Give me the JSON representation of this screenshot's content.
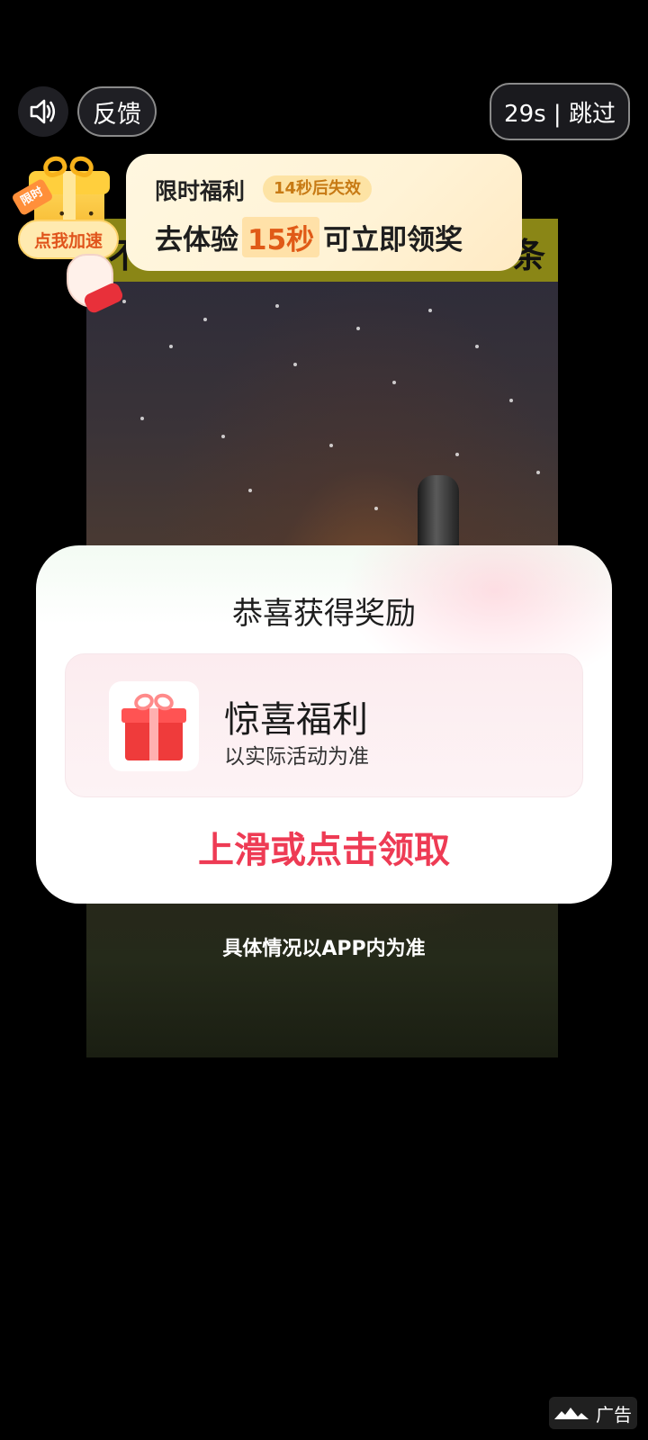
{
  "controls": {
    "sound_icon": "speaker-icon",
    "feedback_label": "反馈",
    "skip_label": "29s | 跳过"
  },
  "benefit_banner": {
    "title": "限时福利",
    "badge": "14秒后失效",
    "main_prefix": "去体验",
    "main_highlight": "15秒",
    "main_suffix": "可立即领奖",
    "highlight_color": "#e05a17"
  },
  "gift_widget": {
    "tag": "限时",
    "pill_label": "点我加速"
  },
  "reward_modal": {
    "title": "恭喜获得奖励",
    "reward_name": "惊喜福利",
    "reward_desc": "以实际活动为准",
    "claim_label": "上滑或点击领取",
    "claim_color": "#ee3b54"
  },
  "disclaimer": "具体情况以APP内为准",
  "ad_tag": {
    "icon": "mountain-logo-icon",
    "label": "广告"
  }
}
